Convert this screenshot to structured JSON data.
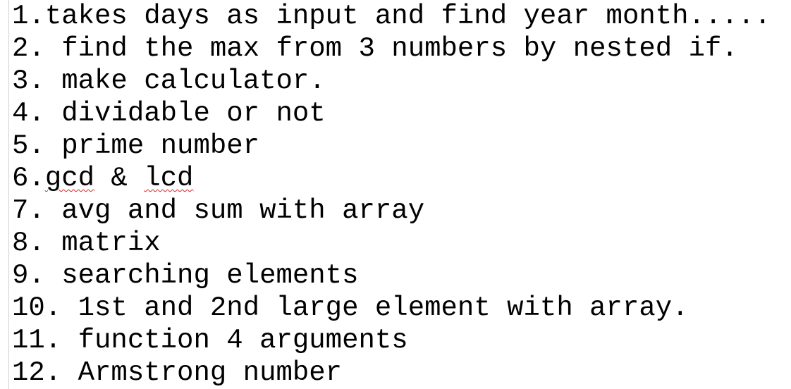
{
  "document": {
    "lines": [
      {
        "number": "1.",
        "sep": "",
        "text": "takes days as input and find year month....."
      },
      {
        "number": "2.",
        "sep": " ",
        "text": "find the max from 3 numbers by nested if."
      },
      {
        "number": "3.",
        "sep": " ",
        "text": "make calculator."
      },
      {
        "number": "4.",
        "sep": " ",
        "text": "dividable or not"
      },
      {
        "number": "5.",
        "sep": " ",
        "text": "prime number"
      },
      {
        "number": "6.",
        "sep": "",
        "text_a": "gcd",
        "text_mid": " & ",
        "text_b": "lcd"
      },
      {
        "number": "7.",
        "sep": " ",
        "text": "avg and sum with array"
      },
      {
        "number": "8.",
        "sep": " ",
        "text": "matrix"
      },
      {
        "number": "9.",
        "sep": " ",
        "text": "searching elements"
      },
      {
        "number": "10.",
        "sep": " ",
        "text": "1st and 2nd large element with array."
      },
      {
        "number": "11.",
        "sep": " ",
        "text": "function 4 arguments"
      },
      {
        "number": "12.",
        "sep": " ",
        "text": "Armstrong number"
      }
    ],
    "spellcheck_color": "#e02020",
    "text_color": "#000000",
    "background": "#ffffff"
  }
}
